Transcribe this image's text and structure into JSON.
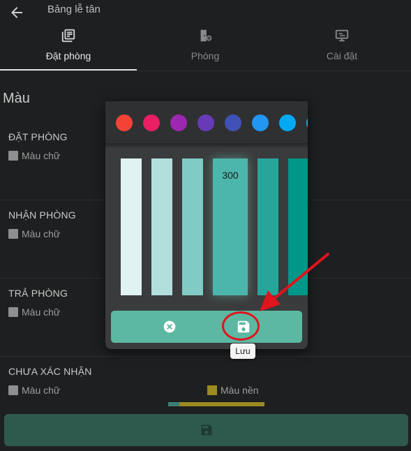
{
  "header": {
    "title": "Bảng lễ tân"
  },
  "tabs": [
    {
      "label": "Đặt phòng",
      "icon": "booking-icon"
    },
    {
      "label": "Phòng",
      "icon": "room-settings-icon"
    },
    {
      "label": "Cài đặt",
      "icon": "settings-monitor-icon"
    }
  ],
  "section": {
    "title": "Màu"
  },
  "groups": [
    {
      "title": "ĐẶT PHÒNG",
      "text_color_label": "Màu chữ"
    },
    {
      "title": "NHẬN PHÒNG",
      "text_color_label": "Màu chữ"
    },
    {
      "title": "TRẢ PHÒNG",
      "text_color_label": "Màu chữ"
    },
    {
      "title": "CHƯA XÁC NHẬN",
      "text_color_label": "Màu chữ",
      "bg_color_label": "Màu nền"
    }
  ],
  "dialog": {
    "hues": [
      "#f44336",
      "#e91e63",
      "#9c27b0",
      "#673ab7",
      "#3f51b5",
      "#2196f3",
      "#03a9f4",
      "#00bcd4"
    ],
    "shades": [
      "#e0f2f1",
      "#b2dfdb",
      "#80cbc4",
      "#4db6ac",
      "#26a69a",
      "#009688"
    ],
    "selected_shade_label": "300",
    "tooltip": "Lưu"
  },
  "colors": {
    "accent": "#5cb8a2",
    "highlight": "#e0141c",
    "save_bar": "#2d5a4c"
  }
}
